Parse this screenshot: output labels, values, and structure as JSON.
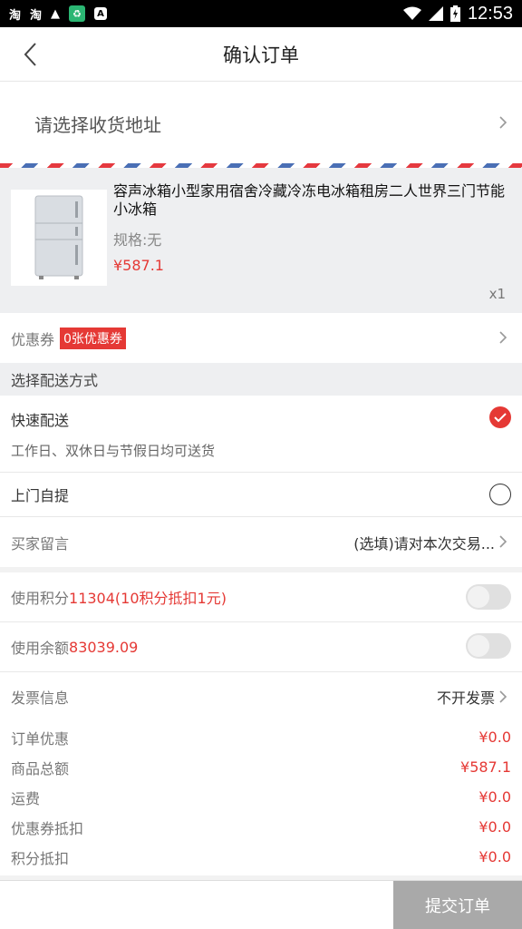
{
  "status_bar": {
    "time": "12:53",
    "icons": [
      "taobao-icon",
      "taobao-icon",
      "warning-icon",
      "recycle-app-icon",
      "a-icon",
      "wifi-icon",
      "signal-icon",
      "battery-charging-icon"
    ],
    "left_labels": [
      "淘",
      "淘",
      "▲",
      "♻",
      "A"
    ]
  },
  "nav": {
    "title": "确认订单",
    "back_icon": "chevron-left-icon"
  },
  "address": {
    "label": "请选择收货地址"
  },
  "product": {
    "name": "容声冰箱小型家用宿舍冷藏冷冻电冰箱租房二人世界三门节能小冰箱",
    "spec": "规格:无",
    "price": "¥587.1",
    "qty": "x1"
  },
  "coupon": {
    "label": "优惠券",
    "badge": "0张优惠券"
  },
  "delivery": {
    "header": "选择配送方式",
    "options": [
      {
        "label": "快速配送",
        "desc": "工作日、双休日与节假日均可送货",
        "selected": true
      },
      {
        "label": "上门自提",
        "selected": false
      }
    ]
  },
  "message": {
    "label": "买家留言",
    "placeholder": "(选填)请对本次交易..."
  },
  "points": {
    "label": "使用积分",
    "value": "11304(10积分抵扣1元)",
    "enabled": false
  },
  "balance": {
    "label": "使用余额",
    "value": "83039.09",
    "enabled": false
  },
  "invoice": {
    "label": "发票信息",
    "value": "不开发票"
  },
  "summary": [
    {
      "key": "订单优惠",
      "value": "¥0.0"
    },
    {
      "key": "商品总额",
      "value": "¥587.1"
    },
    {
      "key": "运费",
      "value": "¥0.0"
    },
    {
      "key": "优惠券抵扣",
      "value": "¥0.0"
    },
    {
      "key": "积分抵扣",
      "value": "¥0.0"
    }
  ],
  "submit": {
    "label": "提交订单"
  },
  "colors": {
    "accent": "#e53935",
    "submit_disabled": "#a9a9a9"
  }
}
